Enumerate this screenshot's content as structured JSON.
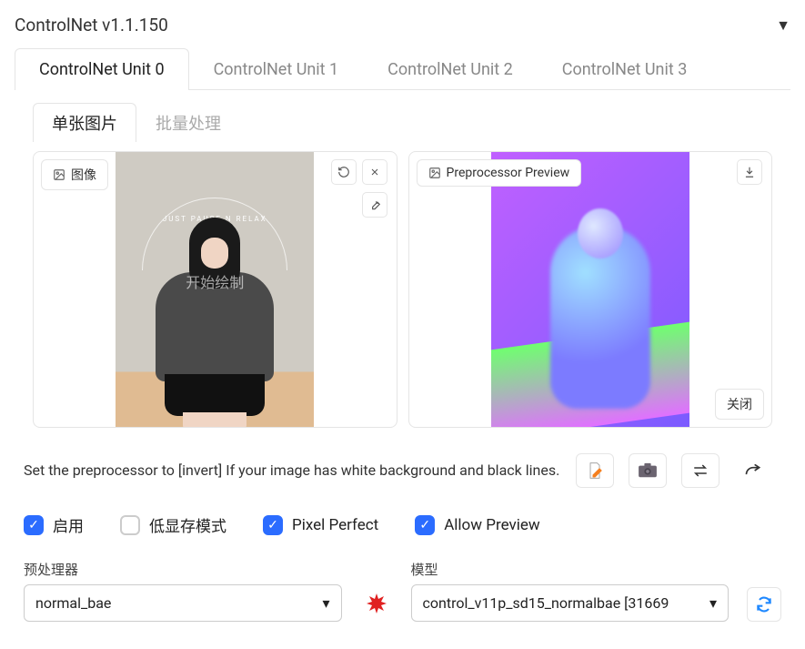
{
  "header": {
    "title": "ControlNet v1.1.150"
  },
  "main_tabs": [
    "ControlNet Unit 0",
    "ControlNet Unit 1",
    "ControlNet Unit 2",
    "ControlNet Unit 3"
  ],
  "inner_tabs": [
    "单张图片",
    "批量处理"
  ],
  "left_panel": {
    "badge": "图像",
    "watermark": "开始绘制"
  },
  "right_panel": {
    "badge": "Preprocessor Preview",
    "close": "关闭"
  },
  "hint": "Set the preprocessor to [invert] If your image has white background and black lines.",
  "checks": {
    "enable": "启用",
    "lowvram": "低显存模式",
    "pixel": "Pixel Perfect",
    "preview": "Allow Preview"
  },
  "preproc": {
    "label": "预处理器",
    "value": "normal_bae"
  },
  "model": {
    "label": "模型",
    "value": "control_v11p_sd15_normalbae [31669"
  },
  "icons": {
    "doc": "📝",
    "camera": "📷",
    "swap": "⇄",
    "send": "↪",
    "explode": "💥",
    "refresh": "🔁"
  }
}
